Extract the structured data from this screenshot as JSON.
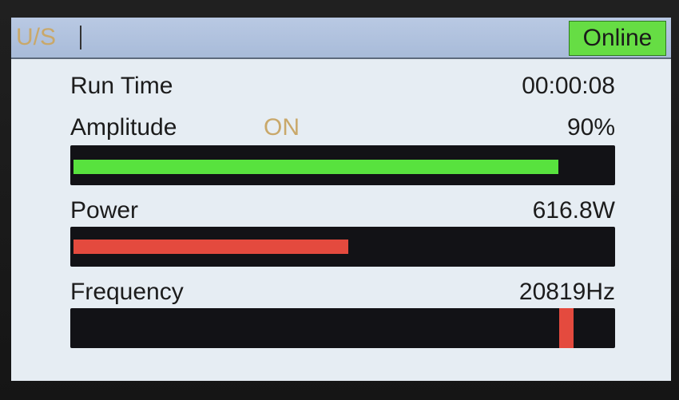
{
  "header": {
    "title": "U/S",
    "status": "Online"
  },
  "run_time": {
    "label": "Run Time",
    "value": "00:00:08"
  },
  "amplitude": {
    "label": "Amplitude",
    "state": "ON",
    "value": "90%",
    "level_fraction": 0.9
  },
  "power": {
    "label": "Power",
    "value": "616.8W",
    "level_fraction": 0.51
  },
  "frequency": {
    "label": "Frequency",
    "value": "20819Hz",
    "marker_fraction": 0.91
  },
  "colors": {
    "header_bg": "#a8bbd9",
    "online_bg": "#66dd44",
    "amplitude_bar": "#58e23e",
    "power_bar": "#e44a3e",
    "frequency_marker": "#e44a3e",
    "track": "#121216",
    "screen_bg": "#e6edf3"
  }
}
